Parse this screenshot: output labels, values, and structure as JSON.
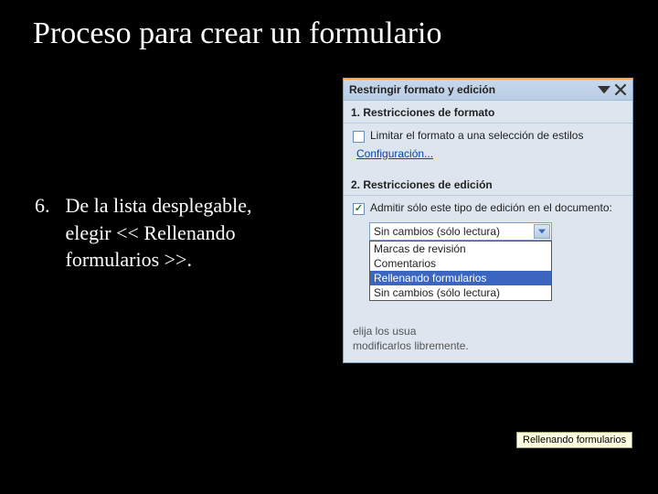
{
  "slide": {
    "title": "Proceso para crear un formulario",
    "step_number": "6.",
    "step_text": "De la lista desplegable, elegir << Rellenando formularios >>."
  },
  "panel": {
    "title": "Restringir formato y edición",
    "sec1": {
      "head": "1. Restricciones de formato",
      "checkbox_label": "Limitar el formato a una selección de estilos",
      "config_link": "Configuración..."
    },
    "sec2": {
      "head": "2. Restricciones de edición",
      "checkbox_label": "Admitir sólo este tipo de edición en el documento:"
    },
    "dropdown": {
      "selected": "Sin cambios (sólo lectura)",
      "options": [
        "Marcas de revisión",
        "Comentarios",
        "Rellenando formularios",
        "Sin cambios (sólo lectura)"
      ],
      "highlighted_index": 2
    },
    "below_partial": "elija los usua\nmodificarlos libremente."
  },
  "tooltip": "Rellenando formularios"
}
